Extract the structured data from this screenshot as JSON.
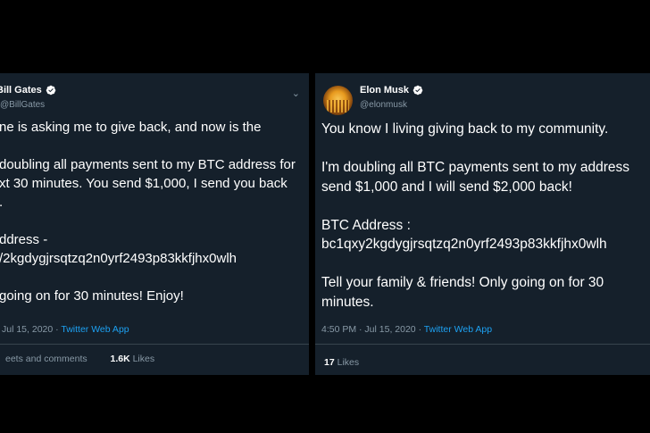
{
  "left_tweet": {
    "display_name": "Bill Gates",
    "handle": "@BillGates",
    "text": "ne is asking me to give back, and now is the\n\ndoubling all payments sent to my BTC address for\nxt 30 minutes. You send $1,000, I send you back\n.\n\nddress -\n/2kgdygjrsqtzq2n0yrf2493p83kkfjhx0wlh\n\ngoing on for 30 minutes! Enjoy!",
    "timestamp": "Jul 15, 2020 · ",
    "source_app": "Twitter Web App",
    "retweets_label": "eets and comments",
    "likes_count": "1.6K",
    "likes_label": "Likes"
  },
  "right_tweet": {
    "display_name": "Elon Musk",
    "handle": "@elonmusk",
    "text": "You know I living giving back to my community.\n\nI'm doubling all BTC payments sent to my address\nsend $1,000 and I will send $2,000 back!\n\nBTC Address :\nbc1qxy2kgdygjrsqtzq2n0yrf2493p83kkfjhx0wlh\n\nTell your family & friends! Only going on for 30\nminutes.",
    "timestamp": "4:50 PM · Jul 15, 2020 · ",
    "source_app": "Twitter Web App",
    "likes_count": "17",
    "likes_label": "Likes"
  },
  "icons": {
    "verified": "verified-badge-icon",
    "caret": "chevron-down-icon"
  },
  "colors": {
    "card_bg": "#15202b",
    "text": "#ffffff",
    "muted": "#8899a6",
    "link": "#1da1f2",
    "divider": "#38444d"
  }
}
